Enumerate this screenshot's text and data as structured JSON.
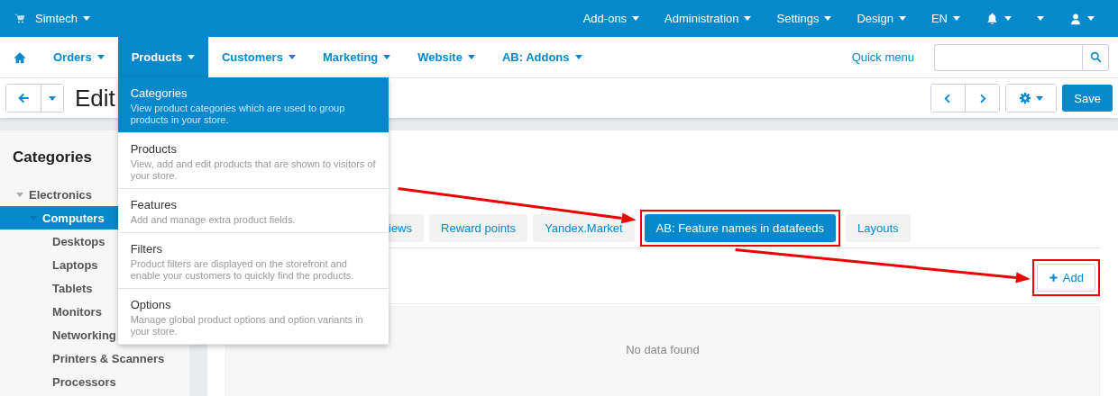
{
  "top_bar": {
    "store": "Simtech",
    "items": [
      {
        "kind": "text",
        "label": "Add-ons"
      },
      {
        "kind": "text",
        "label": "Administration"
      },
      {
        "kind": "text",
        "label": "Settings"
      },
      {
        "kind": "text",
        "label": "Design"
      },
      {
        "kind": "text",
        "label": "EN"
      },
      {
        "kind": "bell"
      },
      {
        "kind": "blank"
      },
      {
        "kind": "user"
      }
    ]
  },
  "nav": {
    "items": [
      {
        "kind": "home",
        "selected": false
      },
      {
        "kind": "text",
        "label": "Orders",
        "selected": false
      },
      {
        "kind": "text",
        "label": "Products",
        "selected": true
      },
      {
        "kind": "text",
        "label": "Customers",
        "selected": false
      },
      {
        "kind": "text",
        "label": "Marketing",
        "selected": false
      },
      {
        "kind": "text",
        "label": "Website",
        "selected": false
      },
      {
        "kind": "text",
        "label": "AB: Addons",
        "selected": false
      }
    ],
    "quick_menu": "Quick menu"
  },
  "dropdown": {
    "items": [
      {
        "title": "Categories",
        "description": "View product categories which are used to group products in your store.",
        "selected": true
      },
      {
        "title": "Products",
        "description": "View, add and edit products that are shown to visitors of your store.",
        "selected": false
      },
      {
        "title": "Features",
        "description": "Add and manage extra product fields.",
        "selected": false
      },
      {
        "title": "Filters",
        "description": "Product filters are displayed on the storefront and enable your customers to quickly find the products.",
        "selected": false
      },
      {
        "title": "Options",
        "description": "Manage global product options and option variants in your store.",
        "selected": false
      }
    ]
  },
  "toolbar": {
    "title": "Edit",
    "save": "Save"
  },
  "sidebar": {
    "title": "Categories",
    "tree": [
      {
        "label": "Electronics",
        "expanded": true,
        "selected": false,
        "children": [
          {
            "label": "Computers",
            "expanded": true,
            "selected": true,
            "children": [
              {
                "label": "Desktops",
                "selected": false
              },
              {
                "label": "Laptops",
                "selected": false
              },
              {
                "label": "Tablets",
                "selected": false
              },
              {
                "label": "Monitors",
                "selected": false
              },
              {
                "label": "Networking",
                "selected": false
              },
              {
                "label": "Printers & Scanners",
                "selected": false
              },
              {
                "label": "Processors",
                "selected": false
              }
            ]
          }
        ]
      }
    ]
  },
  "tabs": [
    {
      "label": "iews",
      "selected": false,
      "highlighted": false
    },
    {
      "label": "Reward points",
      "selected": false,
      "highlighted": false
    },
    {
      "label": "Yandex.Market",
      "selected": false,
      "highlighted": false
    },
    {
      "label": "AB: Feature names in datafeeds",
      "selected": true,
      "highlighted": true
    },
    {
      "label": "Layouts",
      "selected": false,
      "highlighted": false
    }
  ],
  "add_button": {
    "label": "Add",
    "highlighted": true
  },
  "empty_message": "No data found"
}
